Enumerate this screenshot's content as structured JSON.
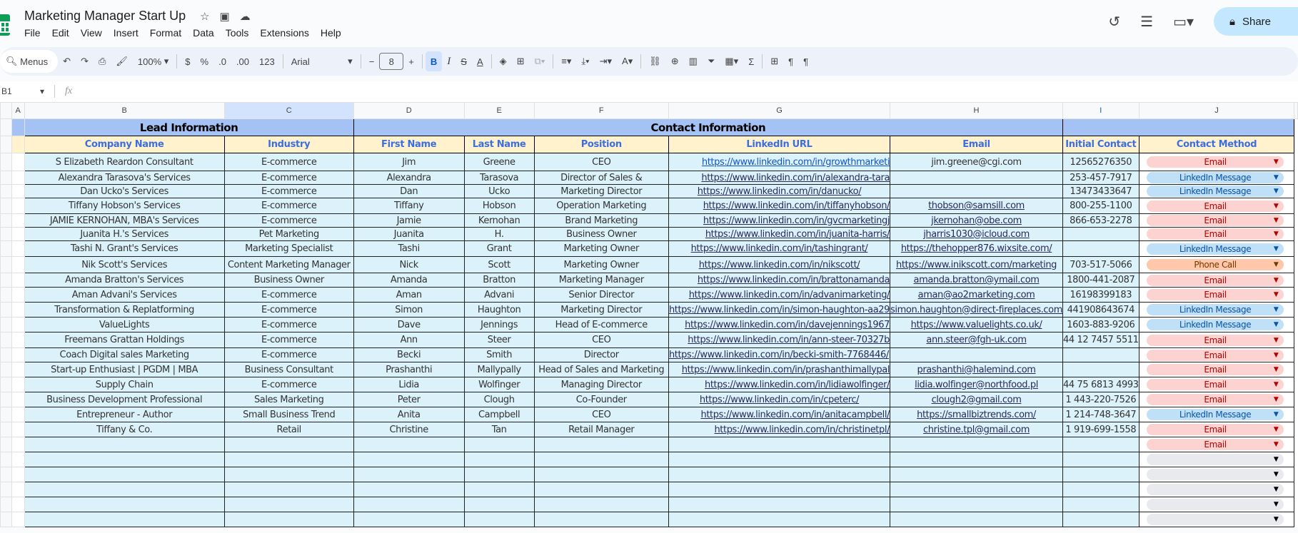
{
  "app": {
    "title": "Marketing Manager Start Up",
    "menu": [
      "File",
      "Edit",
      "View",
      "Insert",
      "Format",
      "Data",
      "Tools",
      "Extensions",
      "Help"
    ],
    "share_label": "Share"
  },
  "toolbar": {
    "menus_label": "Menus",
    "zoom": "100%",
    "currency": "$",
    "percent": "%",
    "dec_dec": ".0",
    "inc_dec": ".00",
    "format_123": "123",
    "font": "Arial",
    "font_size": "8",
    "bold": "B",
    "italic": "I",
    "fx": "fx",
    "cell_ref": "B1"
  },
  "columns": [
    "A",
    "B",
    "C",
    "D",
    "E",
    "F",
    "G",
    "H",
    "I",
    "J"
  ],
  "groups": {
    "lead": "Lead Information",
    "contact": "Contact Information"
  },
  "headers": [
    "Company Name",
    "Industry",
    "First Name",
    "Last Name",
    "Position",
    "LinkedIn URL",
    "Email",
    "Initial Contact",
    "Contact Method"
  ],
  "colors": {
    "Email": "#fcd3d0",
    "Email_text": "#b10202",
    "LinkedIn Message": "#bfe0f6",
    "LinkedIn Message_text": "#0a53a8",
    "Phone Call": "#ffc8aa",
    "Phone Call_text": "#753800",
    "empty": "#e8eaed"
  },
  "rows": [
    [
      "S Elizabeth Reardon Consultant",
      "E-commerce",
      "Jim",
      "Greene",
      "CEO",
      "https://www.linkedin.com/in/growthmarketi",
      "jim.greene@cgi.com",
      "12565276350",
      "Email"
    ],
    [
      "Alexandra Tarasova's Services",
      "E-commerce",
      "Alexandra",
      "Tarasova",
      "Director of Sales &",
      "https://www.linkedin.com/in/alexandra-tara",
      "",
      "253-457-7917",
      "LinkedIn Message"
    ],
    [
      "Dan Ucko's Services",
      "E-commerce",
      "Dan",
      "Ucko",
      "Marketing Director",
      "https://www.linkedin.com/in/danucko/",
      "",
      "13473433647",
      "LinkedIn Message"
    ],
    [
      "Tiffany Hobson's Services",
      "E-commerce",
      "Tiffany",
      "Hobson",
      "Operation Marketing",
      "https://www.linkedin.com/in/tiffanyhobson/",
      "thobson@samsill.com",
      "800-255-1100",
      "Email"
    ],
    [
      "JAMIE KERNOHAN, MBA's Services",
      "E-commerce",
      "Jamie",
      "Kernohan",
      "Brand Marketing",
      "https://www.linkedin.com/in/gvcmarketingj",
      "jkernohan@obe.com",
      "866-653-2278",
      "Email"
    ],
    [
      "Juanita H.'s Services",
      "Pet Marketing",
      "Juanita",
      "H.",
      "Business Owner",
      "https://www.linkedin.com/in/juanita-harris/",
      "jharris1030@icloud.com",
      "",
      "Email"
    ],
    [
      "Tashi N. Grant's Services",
      "Marketing Specialist",
      "Tashi",
      "Grant",
      "Marketing Owner",
      "https://www.linkedin.com/in/tashingrant/",
      "https://thehopper876.wixsite.com/",
      "",
      "LinkedIn Message"
    ],
    [
      "Nik Scott's Services",
      "Content Marketing Manager",
      "Nick",
      "Scott",
      "Marketing Owner",
      "https://www.linkedin.com/in/nikscott/",
      "https://www.inikscott.com/marketing",
      "703-517-5066",
      "Phone Call"
    ],
    [
      "Amanda Bratton's Services",
      "Business Owner",
      "Amanda",
      "Bratton",
      "Marketing Manager",
      "https://www.linkedin.com/in/brattonamanda",
      "amanda.bratton@ymail.com",
      "1800-441-2087",
      "Email"
    ],
    [
      "Aman Advani's Services",
      "E-commerce",
      "Aman",
      "Advani",
      "Senior Director",
      "https://www.linkedin.com/in/advanimarketing/",
      "aman@ao2marketing.com",
      "16198399183",
      "Email"
    ],
    [
      "Transformation & Replatforming",
      "E-commerce",
      "Simon",
      "Haughton",
      "Marketing Director",
      "https://www.linkedin.com/in/simon-haughton-aa29",
      "simon.haughton@direct-fireplaces.com",
      "441908643674",
      "LinkedIn Message"
    ],
    [
      "ValueLights",
      "E-commerce",
      "Dave",
      "Jennings",
      "Head of E-commerce",
      "https://www.linkedin.com/in/davejennings1967",
      "https://www.valuelights.co.uk/",
      "1603-883-9206",
      "LinkedIn Message"
    ],
    [
      "Freemans Grattan Holdings",
      "E-commerce",
      "Ann",
      "Steer",
      "CEO",
      "https://www.linkedin.com/in/ann-steer-70327b",
      "ann.steer@fgh-uk.com",
      "44 12 7457 5511",
      "Email"
    ],
    [
      "Coach Digital sales Marketing",
      "E-commerce",
      "Becki",
      "Smith",
      "Director",
      "https://www.linkedin.com/in/becki-smith-7768446/",
      "",
      "",
      "Email"
    ],
    [
      "Start-up Enthusiast | PGDM | MBA",
      "Business Consultant",
      "Prashanthi",
      "Mallypally",
      "Head of Sales and Marketing",
      "https://www.linkedin.com/in/prashanthimallypal",
      "prashanthi@halemind.com",
      "",
      "Email"
    ],
    [
      "Supply Chain",
      "E-commerce",
      "Lidia",
      "Wolfinger",
      "Managing Director",
      "https://www.linkedin.com/in/lidiawolfinger/",
      "lidia.wolfinger@northfood.pl",
      "44 75 6813 4993",
      "Email"
    ],
    [
      "Business Development Professional",
      "Sales Marketing",
      "Peter",
      "Clough",
      "Co-Founder",
      "https://www.linkedin.com/in/cpeterc/",
      "clough2@gmail.com",
      "1 443-220-7526",
      "Email"
    ],
    [
      "Entrepreneur - Author",
      "Small Business Trend",
      "Anita",
      "Campbell",
      "CEO",
      "https://www.linkedin.com/in/anitacampbell/",
      "https://smallbiztrends.com/",
      "1 214-748-3647",
      "LinkedIn Message"
    ],
    [
      "Tiffany & Co.",
      "Retail",
      "Christine",
      "Tan",
      "Retail Manager",
      "https://www.linkedin.com/in/christinetpl/",
      "christine.tpl@gmail.com",
      "1 919-699-1558",
      "Email"
    ],
    [
      "",
      "",
      "",
      "",
      "",
      "",
      "",
      "",
      "Email"
    ],
    [
      "",
      "",
      "",
      "",
      "",
      "",
      "",
      "",
      ""
    ],
    [
      "",
      "",
      "",
      "",
      "",
      "",
      "",
      "",
      ""
    ],
    [
      "",
      "",
      "",
      "",
      "",
      "",
      "",
      "",
      ""
    ],
    [
      "",
      "",
      "",
      "",
      "",
      "",
      "",
      "",
      ""
    ],
    [
      "",
      "",
      "",
      "",
      "",
      "",
      "",
      "",
      ""
    ]
  ]
}
